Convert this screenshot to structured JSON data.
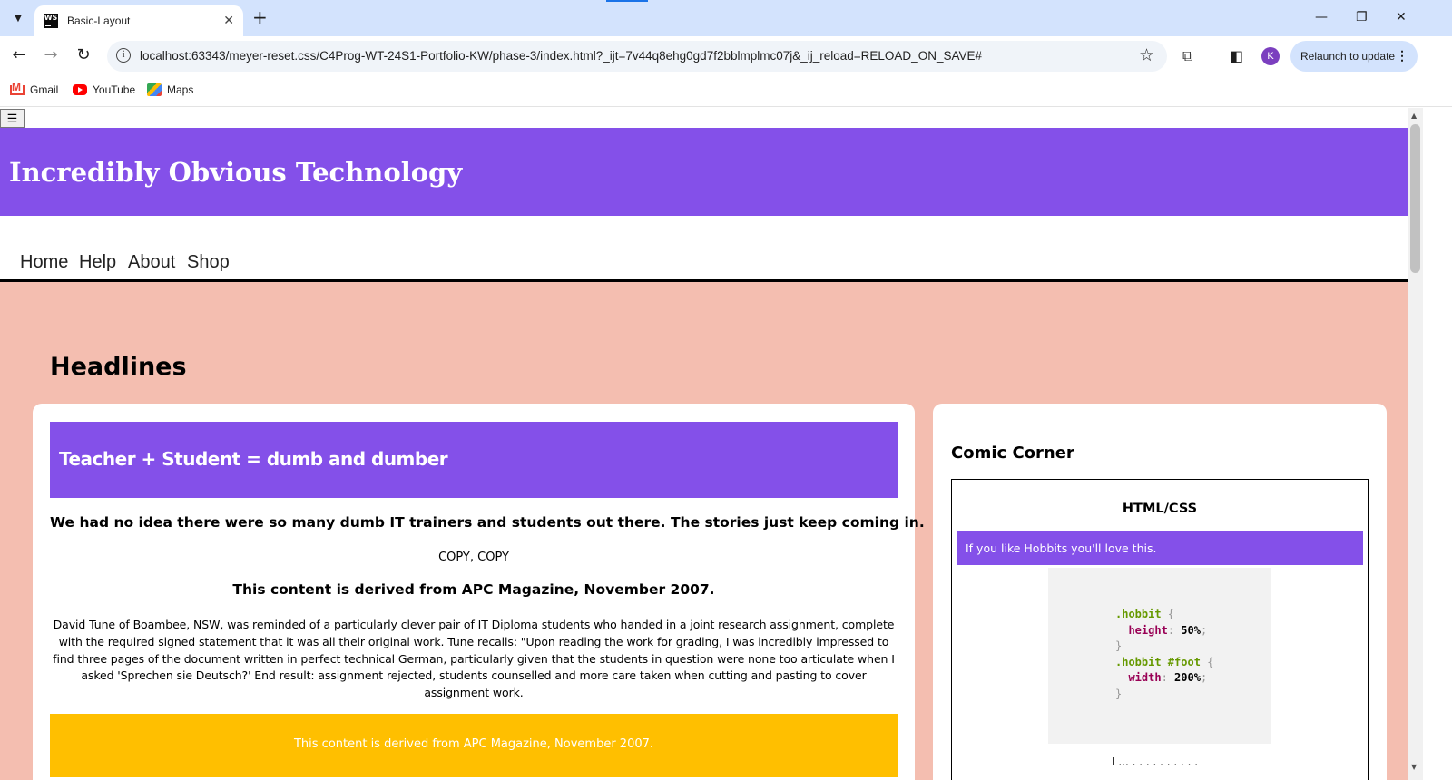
{
  "browser": {
    "tab_title": "Basic-Layout",
    "favicon_text": "WS",
    "url": "localhost:63343/meyer-reset.css/C4Prog-WT-24S1-Portfolio-KW/phase-3/index.html?_ijt=7v44q8ehg0gd7f2bblmplmc07j&_ij_reload=RELOAD_ON_SAVE#",
    "profile_initial": "K",
    "relaunch_label": "Relaunch to update",
    "bookmarks": [
      "Gmail",
      "YouTube",
      "Maps"
    ]
  },
  "page": {
    "menu_toggle": "☰",
    "site_title": "Incredibly Obvious Technology",
    "nav": [
      "Home",
      "Help",
      "About",
      "Shop"
    ],
    "section_heading": "Headlines",
    "article": {
      "title": "Teacher + Student = dumb and dumber",
      "subtitle": "We had no idea there were so many dumb IT trainers and students out there. The stories just keep coming in.",
      "copy": "COPY, COPY",
      "source": "This content is derived from APC Magazine, November 2007.",
      "body": "David Tune of Boambee, NSW, was reminded of a particularly clever pair of IT Diploma students who handed in a joint research assignment, complete with the required signed statement that it was all their original work. Tune recalls: \"Upon reading the work for grading, I was incredibly impressed to find three pages of the document written in perfect technical German, particularly given that the students in question were none too articulate when I asked 'Sprechen sie Deutsch?' End result: assignment rejected, students counselled and more care taken when cutting and pasting to cover assignment work.",
      "footer_note": "This content is derived from APC Magazine, November 2007."
    },
    "sidebar": {
      "title": "Comic Corner",
      "comic_heading": "HTML/CSS",
      "comic_caption": "If you like Hobbits you'll love this.",
      "code": {
        "line1_selector": ".hobbit",
        "line2_property": "height",
        "line2_value": "50%",
        "line4_selector": ".hobbit #foot",
        "line5_property": "width",
        "line5_value": "200%"
      },
      "comic_tail": "I ... . . . . . . . . . ."
    }
  },
  "colors": {
    "header_purple": "#8450e9",
    "page_background": "#f4beb0",
    "footer_amber": "#ffbf00",
    "tabbar": "#d3e3fd"
  }
}
